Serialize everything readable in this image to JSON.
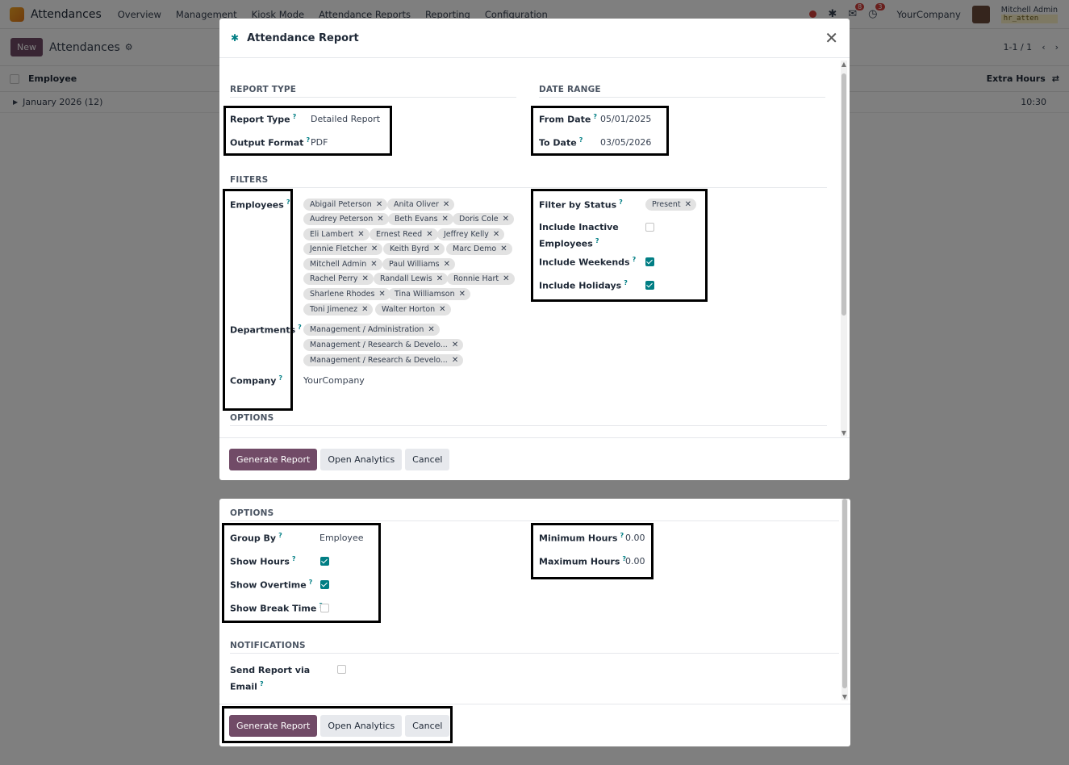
{
  "app": {
    "name": "Attendances",
    "menu": [
      "Overview",
      "Management",
      "Kiosk Mode",
      "Attendance Reports",
      "Reporting",
      "Configuration"
    ],
    "badges": {
      "messages": "8",
      "activities": "3"
    },
    "company": "YourCompany",
    "user": "Mitchell Admin",
    "database": "hr_atten"
  },
  "control": {
    "new_label": "New",
    "breadcrumb": "Attendances",
    "pager": "1-1 / 1"
  },
  "list": {
    "col_employee": "Employee",
    "col_extra": "Extra Hours",
    "group_label": "January 2026 (12)",
    "group_value": "10:30"
  },
  "dialog": {
    "title": "Attendance Report",
    "sections": {
      "report_type": "REPORT TYPE",
      "date_range": "DATE RANGE",
      "filters": "FILTERS",
      "options": "OPTIONS",
      "notifications": "NOTIFICATIONS"
    },
    "fields": {
      "report_type": {
        "label": "Report Type",
        "value": "Detailed Report"
      },
      "output_format": {
        "label": "Output Format",
        "value": "PDF"
      },
      "from_date": {
        "label": "From Date",
        "value": "05/01/2025"
      },
      "to_date": {
        "label": "To Date",
        "value": "03/05/2026"
      },
      "employees": {
        "label": "Employees"
      },
      "departments": {
        "label": "Departments"
      },
      "company": {
        "label": "Company",
        "value": "YourCompany"
      },
      "filter_status": {
        "label": "Filter by Status",
        "value": "Present"
      },
      "include_inactive": {
        "label_1": "Include Inactive",
        "label_2": "Employees",
        "checked": false
      },
      "include_weekends": {
        "label": "Include Weekends",
        "checked": true
      },
      "include_holidays": {
        "label": "Include Holidays",
        "checked": true
      },
      "group_by": {
        "label": "Group By",
        "value": "Employee"
      },
      "show_hours": {
        "label": "Show Hours",
        "checked": true
      },
      "show_overtime": {
        "label": "Show Overtime",
        "checked": true
      },
      "show_break": {
        "label": "Show Break Time",
        "checked": false
      },
      "min_hours": {
        "label": "Minimum Hours",
        "value": "0.00"
      },
      "max_hours": {
        "label": "Maximum Hours",
        "value": "0.00"
      },
      "send_email": {
        "label_1": "Send Report via",
        "label_2": "Email",
        "checked": false
      }
    },
    "employees": [
      "Abigail Peterson",
      "Anita Oliver",
      "Audrey Peterson",
      "Beth Evans",
      "Doris Cole",
      "Eli Lambert",
      "Ernest Reed",
      "Jeffrey Kelly",
      "Jennie Fletcher",
      "Keith Byrd",
      "Marc Demo",
      "Mitchell Admin",
      "Paul Williams",
      "Rachel Perry",
      "Randall Lewis",
      "Ronnie Hart",
      "Sharlene Rhodes",
      "Tina Williamson",
      "Toni Jimenez",
      "Walter Horton"
    ],
    "departments": [
      "Management / Administration",
      "Management / Research & Develo...",
      "Management / Research & Develo..."
    ],
    "buttons": {
      "generate": "Generate Report",
      "analytics": "Open Analytics",
      "cancel": "Cancel"
    }
  }
}
